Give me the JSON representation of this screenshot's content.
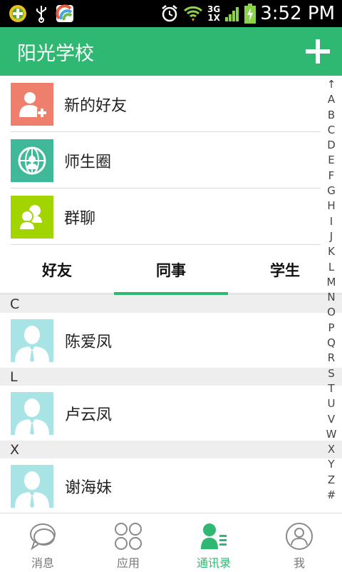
{
  "status_bar": {
    "time": "3:52 PM",
    "network_top": "3G",
    "network_bottom": "1X"
  },
  "app_bar": {
    "title": "阳光学校"
  },
  "entries": [
    {
      "label": "新的好友",
      "icon": "add-friend-icon",
      "color": "#ee7f6d"
    },
    {
      "label": "师生圈",
      "icon": "teacher-student-circle-icon",
      "color": "#3fb99a"
    },
    {
      "label": "群聊",
      "icon": "group-chat-icon",
      "color": "#a2d400"
    }
  ],
  "tabs": [
    "好友",
    "同事",
    "学生"
  ],
  "active_tab": 1,
  "sections": [
    {
      "letter": "C",
      "contacts": [
        "陈爱凤"
      ]
    },
    {
      "letter": "L",
      "contacts": [
        "卢云凤"
      ]
    },
    {
      "letter": "X",
      "contacts": [
        "谢海妹"
      ]
    }
  ],
  "index_letters": [
    "↑",
    "A",
    "B",
    "C",
    "D",
    "E",
    "F",
    "G",
    "H",
    "I",
    "J",
    "K",
    "L",
    "M",
    "N",
    "O",
    "P",
    "Q",
    "R",
    "S",
    "T",
    "U",
    "V",
    "W",
    "X",
    "Y",
    "Z",
    "#"
  ],
  "bottom_nav": [
    {
      "label": "消息",
      "icon": "message-icon"
    },
    {
      "label": "应用",
      "icon": "apps-icon"
    },
    {
      "label": "通讯录",
      "icon": "contacts-icon"
    },
    {
      "label": "我",
      "icon": "profile-icon"
    }
  ],
  "active_nav": 2,
  "colors": {
    "accent": "#2eb872",
    "avatar_bg": "#a8e3e6"
  }
}
